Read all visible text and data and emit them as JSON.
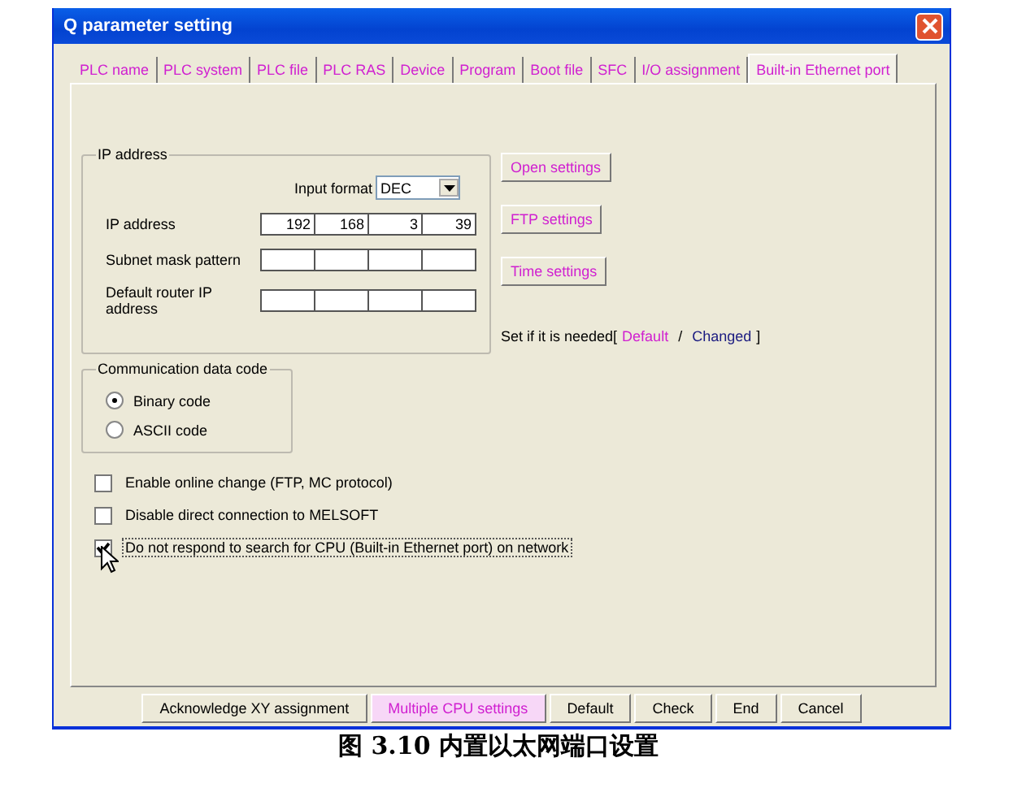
{
  "window": {
    "title": "Q parameter setting"
  },
  "tabs": [
    {
      "label": "PLC name",
      "selected": false
    },
    {
      "label": "PLC system",
      "selected": false
    },
    {
      "label": "PLC file",
      "selected": false
    },
    {
      "label": "PLC RAS",
      "selected": false
    },
    {
      "label": "Device",
      "selected": false
    },
    {
      "label": "Program",
      "selected": false
    },
    {
      "label": "Boot file",
      "selected": false
    },
    {
      "label": "SFC",
      "selected": false
    },
    {
      "label": "I/O assignment",
      "selected": false
    },
    {
      "label": "Built-in Ethernet port",
      "selected": true
    }
  ],
  "ip_group": {
    "title": "IP address",
    "input_format_label": "Input format",
    "input_format": "DEC",
    "rows": [
      {
        "label": "IP address",
        "octets": [
          "192",
          "168",
          "3",
          "39"
        ]
      },
      {
        "label": "Subnet mask pattern"
      },
      {
        "label": "Default router IP address"
      }
    ]
  },
  "setting_buttons": [
    "Open settings",
    "FTP settings",
    "Time settings"
  ],
  "legend": {
    "text": "Set if it is needed[",
    "default": "Default",
    "separator": "/",
    "changed": "Changed",
    "end": "]"
  },
  "code_group": {
    "title": "Communication data code",
    "options": [
      {
        "label": "Binary code",
        "selected": true
      },
      {
        "label": "ASCII code",
        "selected": false
      }
    ]
  },
  "checkboxes": [
    {
      "label": "Enable online change (FTP, MC protocol)",
      "checked": false,
      "focused": false
    },
    {
      "label": "Disable direct connection to MELSOFT",
      "checked": false,
      "focused": false
    },
    {
      "label": "Do not respond to search for CPU (Built-in Ethernet port) on network",
      "checked": true,
      "focused": true
    }
  ],
  "bottom_buttons": [
    {
      "label": "Acknowledge XY assignment",
      "kind": "plain"
    },
    {
      "label": "Multiple CPU settings",
      "kind": "highlight"
    },
    {
      "label": "Default",
      "kind": "plain"
    },
    {
      "label": "Check",
      "kind": "plain"
    },
    {
      "label": "End",
      "kind": "plain"
    },
    {
      "label": "Cancel",
      "kind": "plain"
    }
  ],
  "caption": "图 3.10 内置以太网端口设置"
}
